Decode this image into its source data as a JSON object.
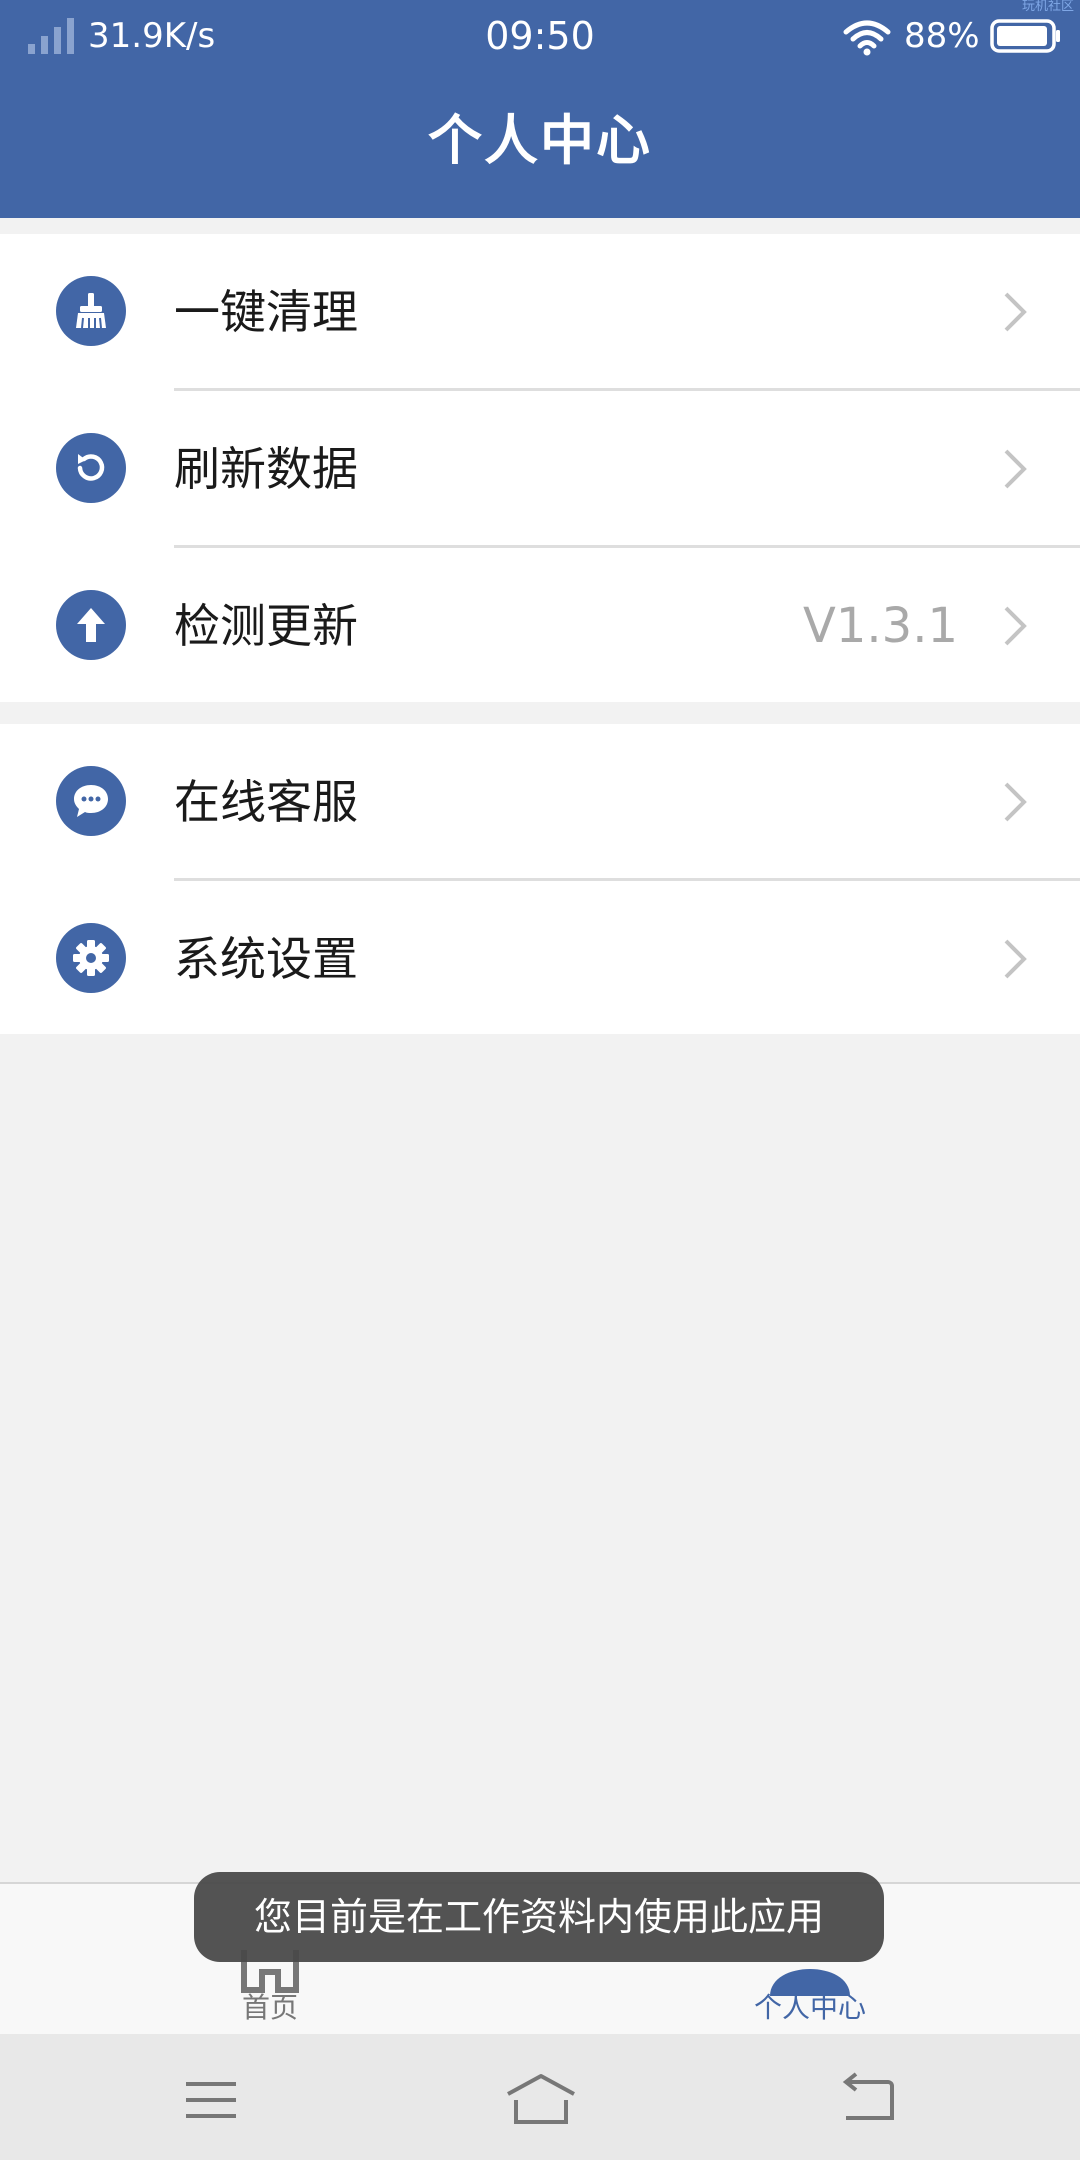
{
  "status_bar": {
    "net_speed": "31.9K/s",
    "time": "09:50",
    "battery": "88%",
    "corner_watermark": "玩机社区"
  },
  "header": {
    "title": "个人中心"
  },
  "menu": {
    "group1": [
      {
        "label": "一键清理",
        "icon": "broom-icon",
        "value": ""
      },
      {
        "label": "刷新数据",
        "icon": "refresh-icon",
        "value": ""
      },
      {
        "label": "检测更新",
        "icon": "upload-arrow-icon",
        "value": "V1.3.1"
      }
    ],
    "group2": [
      {
        "label": "在线客服",
        "icon": "chat-bubble-icon",
        "value": ""
      },
      {
        "label": "系统设置",
        "icon": "gear-icon",
        "value": ""
      }
    ]
  },
  "tabbar": {
    "home_label": "首页",
    "profile_label": "个人中心",
    "active_tab": "个人中心"
  },
  "toast": {
    "message": "您目前是在工作资料内使用此应用"
  },
  "colors": {
    "primary": "#4266a6",
    "background": "#f2f2f2",
    "chevron": "#c4c4c4",
    "value_text": "#a9a9a9"
  }
}
